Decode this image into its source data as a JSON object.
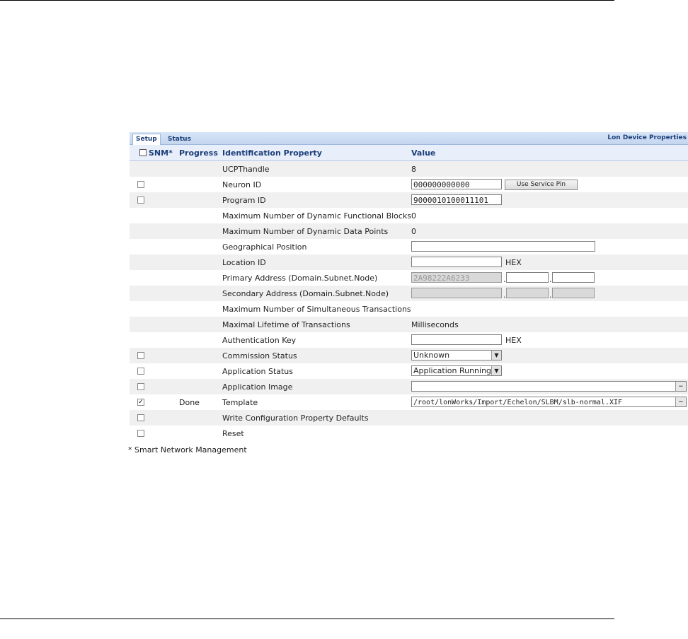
{
  "tabs": [
    "Setup",
    "Status"
  ],
  "panel_title": "Lon Device Properties",
  "header": {
    "snm": "SNM*",
    "progress": "Progress",
    "property": "Identification Property",
    "value": "Value"
  },
  "rows": [
    {
      "label": "UCPThandle",
      "value": "8"
    },
    {
      "label": "Neuron ID",
      "input": "000000000000",
      "button": "Use Service Pin"
    },
    {
      "label": "Program ID",
      "input": "9000010100011101"
    },
    {
      "label": "Maximum Number of Dynamic Functional Blocks",
      "value": "0"
    },
    {
      "label": "Maximum Number of Dynamic Data Points",
      "value": "0"
    },
    {
      "label": "Geographical Position",
      "input": ""
    },
    {
      "label": "Location ID",
      "input": "",
      "suffix": "HEX"
    },
    {
      "label": "Primary Address (Domain.Subnet.Node)",
      "domain": "2A98222A6233",
      "subnet": "",
      "node": ""
    },
    {
      "label": "Secondary Address (Domain.Subnet.Node)",
      "domain": "",
      "subnet": "",
      "node": ""
    },
    {
      "label": "Maximum Number of Simultaneous Transactions",
      "value": ""
    },
    {
      "label": "Maximal Lifetime of Transactions",
      "value": "Milliseconds"
    },
    {
      "label": "Authentication Key",
      "input": "",
      "suffix": "HEX"
    },
    {
      "label": "Commission Status",
      "select": "Unknown"
    },
    {
      "label": "Application Status",
      "select": "Application Running"
    },
    {
      "label": "Application Image",
      "file": ""
    },
    {
      "label": "Template",
      "progress": "Done",
      "file": "/root/lonWorks/Import/Echelon/SLBM/slb-normal.XIF"
    },
    {
      "label": "Write Configuration Property Defaults"
    },
    {
      "label": "Reset"
    }
  ],
  "checkboxes": {
    "neuron_id": false,
    "program_id": false,
    "commission_status": false,
    "application_status": false,
    "application_image": false,
    "template": true,
    "write_defaults": false,
    "reset": false,
    "header_snm": false
  },
  "footnote": "* Smart Network Management",
  "icons": {
    "dropdown": "chevron-down-icon",
    "browse": "ellipsis-icon",
    "check": "checkmark-icon"
  }
}
